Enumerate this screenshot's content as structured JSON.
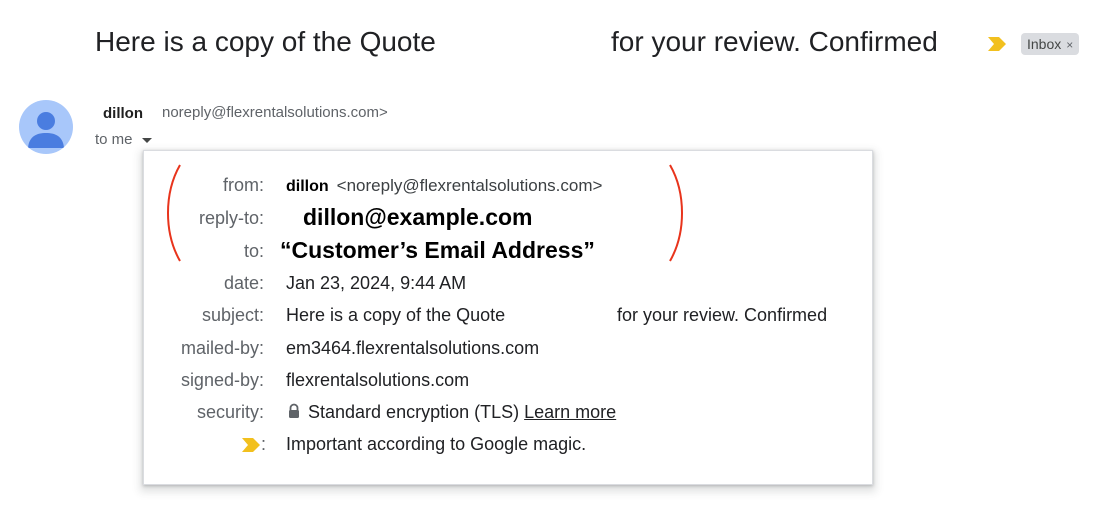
{
  "email": {
    "subject_part1": "Here is a copy of the Quote",
    "subject_part2": "for your review. Confirmed",
    "label_chip": "Inbox",
    "label_chip_close": "×"
  },
  "sender": {
    "name": "dillon",
    "email": "noreply@flexrentalsolutions.com>",
    "to_me": "to me"
  },
  "details": {
    "from_label": "from:",
    "from_name": "dillon",
    "from_email": "<noreply@flexrentalsolutions.com>",
    "replyto_label": "reply-to:",
    "replyto_value": "dillon@example.com",
    "to_label": "to:",
    "to_value": "“Customer’s Email Address”",
    "date_label": "date:",
    "date_value": "Jan 23, 2024, 9:44 AM",
    "subject_label": "subject:",
    "subject_part1": "Here is a copy of the Quote",
    "subject_part2": "for your review. Confirmed",
    "mailedby_label": "mailed-by:",
    "mailedby_value": "em3464.flexrentalsolutions.com",
    "signedby_label": "signed-by:",
    "signedby_value": "flexrentalsolutions.com",
    "security_label": "security:",
    "security_value": "Standard encryption (TLS)",
    "security_link": "Learn more",
    "important_colon": ":",
    "important_value": "Important according to Google magic."
  },
  "colors": {
    "importance_marker": "#f2c01e",
    "annotation_red": "#e8341c",
    "avatar_bg": "#a8c7fa",
    "avatar_fg": "#4a7de0"
  },
  "icons": [
    "importance-marker-icon",
    "close-icon",
    "avatar-person-icon",
    "chevron-down-icon",
    "lock-icon"
  ]
}
